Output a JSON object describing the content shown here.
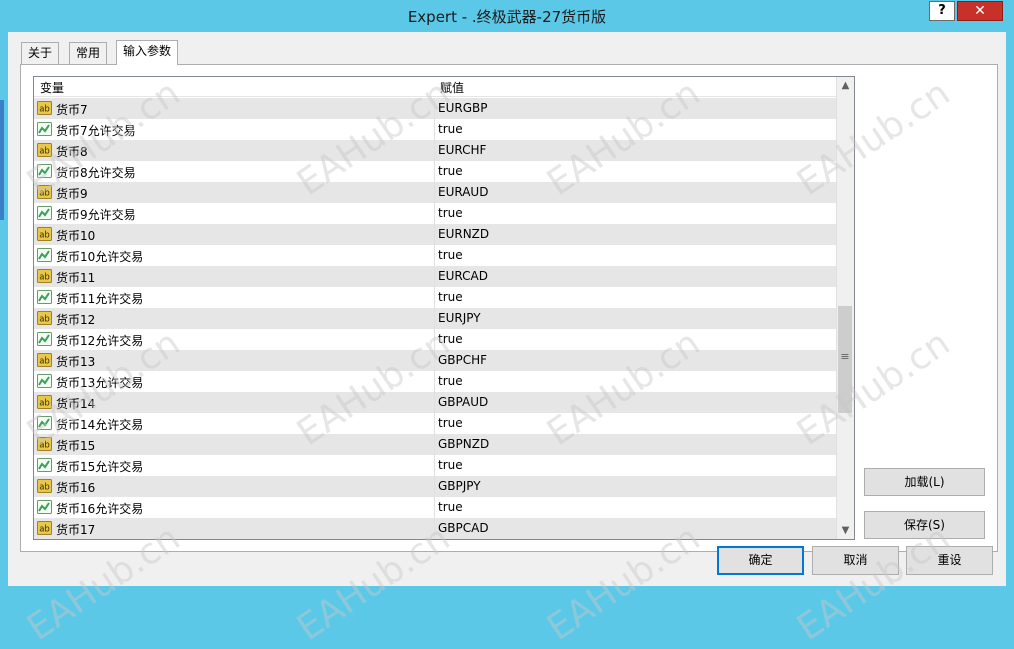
{
  "window": {
    "title": "Expert - .终极武器-27货币版",
    "help_label": "?",
    "close_label": "✕"
  },
  "tabs": [
    {
      "label": "关于",
      "active": false
    },
    {
      "label": "常用",
      "active": false
    },
    {
      "label": "输入参数",
      "active": true
    }
  ],
  "grid": {
    "columns": [
      "变量",
      "赋值"
    ],
    "rows": [
      {
        "name": "货币7",
        "value": "EURGBP",
        "type": "string"
      },
      {
        "name": "货币7允许交易",
        "value": "true",
        "type": "bool"
      },
      {
        "name": "货币8",
        "value": "EURCHF",
        "type": "string"
      },
      {
        "name": "货币8允许交易",
        "value": "true",
        "type": "bool"
      },
      {
        "name": "货币9",
        "value": "EURAUD",
        "type": "string"
      },
      {
        "name": "货币9允许交易",
        "value": "true",
        "type": "bool"
      },
      {
        "name": "货币10",
        "value": "EURNZD",
        "type": "string"
      },
      {
        "name": "货币10允许交易",
        "value": "true",
        "type": "bool"
      },
      {
        "name": "货币11",
        "value": "EURCAD",
        "type": "string"
      },
      {
        "name": "货币11允许交易",
        "value": "true",
        "type": "bool"
      },
      {
        "name": "货币12",
        "value": "EURJPY",
        "type": "string"
      },
      {
        "name": "货币12允许交易",
        "value": "true",
        "type": "bool"
      },
      {
        "name": "货币13",
        "value": "GBPCHF",
        "type": "string"
      },
      {
        "name": "货币13允许交易",
        "value": "true",
        "type": "bool"
      },
      {
        "name": "货币14",
        "value": "GBPAUD",
        "type": "string"
      },
      {
        "name": "货币14允许交易",
        "value": "true",
        "type": "bool"
      },
      {
        "name": "货币15",
        "value": "GBPNZD",
        "type": "string"
      },
      {
        "name": "货币15允许交易",
        "value": "true",
        "type": "bool"
      },
      {
        "name": "货币16",
        "value": "GBPJPY",
        "type": "string"
      },
      {
        "name": "货币16允许交易",
        "value": "true",
        "type": "bool"
      },
      {
        "name": "货币17",
        "value": "GBPCAD",
        "type": "string"
      }
    ],
    "icons": {
      "string": "ab-string-icon",
      "bool": "bool-chart-icon"
    }
  },
  "side_buttons": {
    "load_label": "加载(L)",
    "save_label": "保存(S)"
  },
  "footer_buttons": {
    "ok_label": "确定",
    "cancel_label": "取消",
    "reset_label": "重设"
  },
  "watermark": "EAHub.cn",
  "colors": {
    "title_bar": "#5bc8e8",
    "close_button": "#c7312a",
    "row_alt": "#e6e6e6",
    "string_icon": "#e8c84a",
    "bool_icon": "#3aa05a"
  }
}
